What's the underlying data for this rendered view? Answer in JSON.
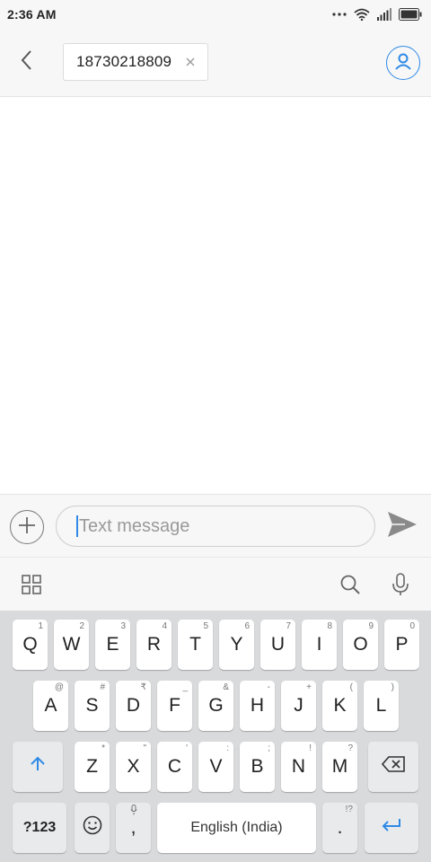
{
  "status_bar": {
    "time": "2:36 AM",
    "icons": [
      "more-dots-icon",
      "wifi-icon",
      "signal-icon",
      "battery-icon"
    ]
  },
  "header": {
    "back_icon": "chevron-left-icon",
    "recipient_number": "18730218809",
    "remove_icon": "close-icon",
    "contact_icon": "person-icon"
  },
  "compose": {
    "attach_icon": "plus-circle-icon",
    "placeholder": "Text message",
    "send_icon": "send-icon"
  },
  "keyboard_toolbar": {
    "icons": [
      "grid-apps-icon",
      "search-icon",
      "microphone-icon"
    ]
  },
  "keyboard": {
    "row1": [
      {
        "key": "Q",
        "hint": "1"
      },
      {
        "key": "W",
        "hint": "2"
      },
      {
        "key": "E",
        "hint": "3"
      },
      {
        "key": "R",
        "hint": "4"
      },
      {
        "key": "T",
        "hint": "5"
      },
      {
        "key": "Y",
        "hint": "6"
      },
      {
        "key": "U",
        "hint": "7"
      },
      {
        "key": "I",
        "hint": "8"
      },
      {
        "key": "O",
        "hint": "9"
      },
      {
        "key": "P",
        "hint": "0"
      }
    ],
    "row2": [
      {
        "key": "A",
        "hint": "@"
      },
      {
        "key": "S",
        "hint": "#"
      },
      {
        "key": "D",
        "hint": "₹"
      },
      {
        "key": "F",
        "hint": "_"
      },
      {
        "key": "G",
        "hint": "&"
      },
      {
        "key": "H",
        "hint": "-"
      },
      {
        "key": "J",
        "hint": "+"
      },
      {
        "key": "K",
        "hint": "("
      },
      {
        "key": "L",
        "hint": ")"
      }
    ],
    "row3": [
      {
        "key": "Z",
        "hint": "*"
      },
      {
        "key": "X",
        "hint": "\""
      },
      {
        "key": "C",
        "hint": "'"
      },
      {
        "key": "V",
        "hint": ":"
      },
      {
        "key": "B",
        "hint": ";"
      },
      {
        "key": "N",
        "hint": "!"
      },
      {
        "key": "M",
        "hint": "?"
      }
    ],
    "symbols_label": "?123",
    "comma": ",",
    "space_label": "English (India)",
    "period": ".",
    "period_hint": "!?",
    "accent_color": "#2e8ae6"
  }
}
